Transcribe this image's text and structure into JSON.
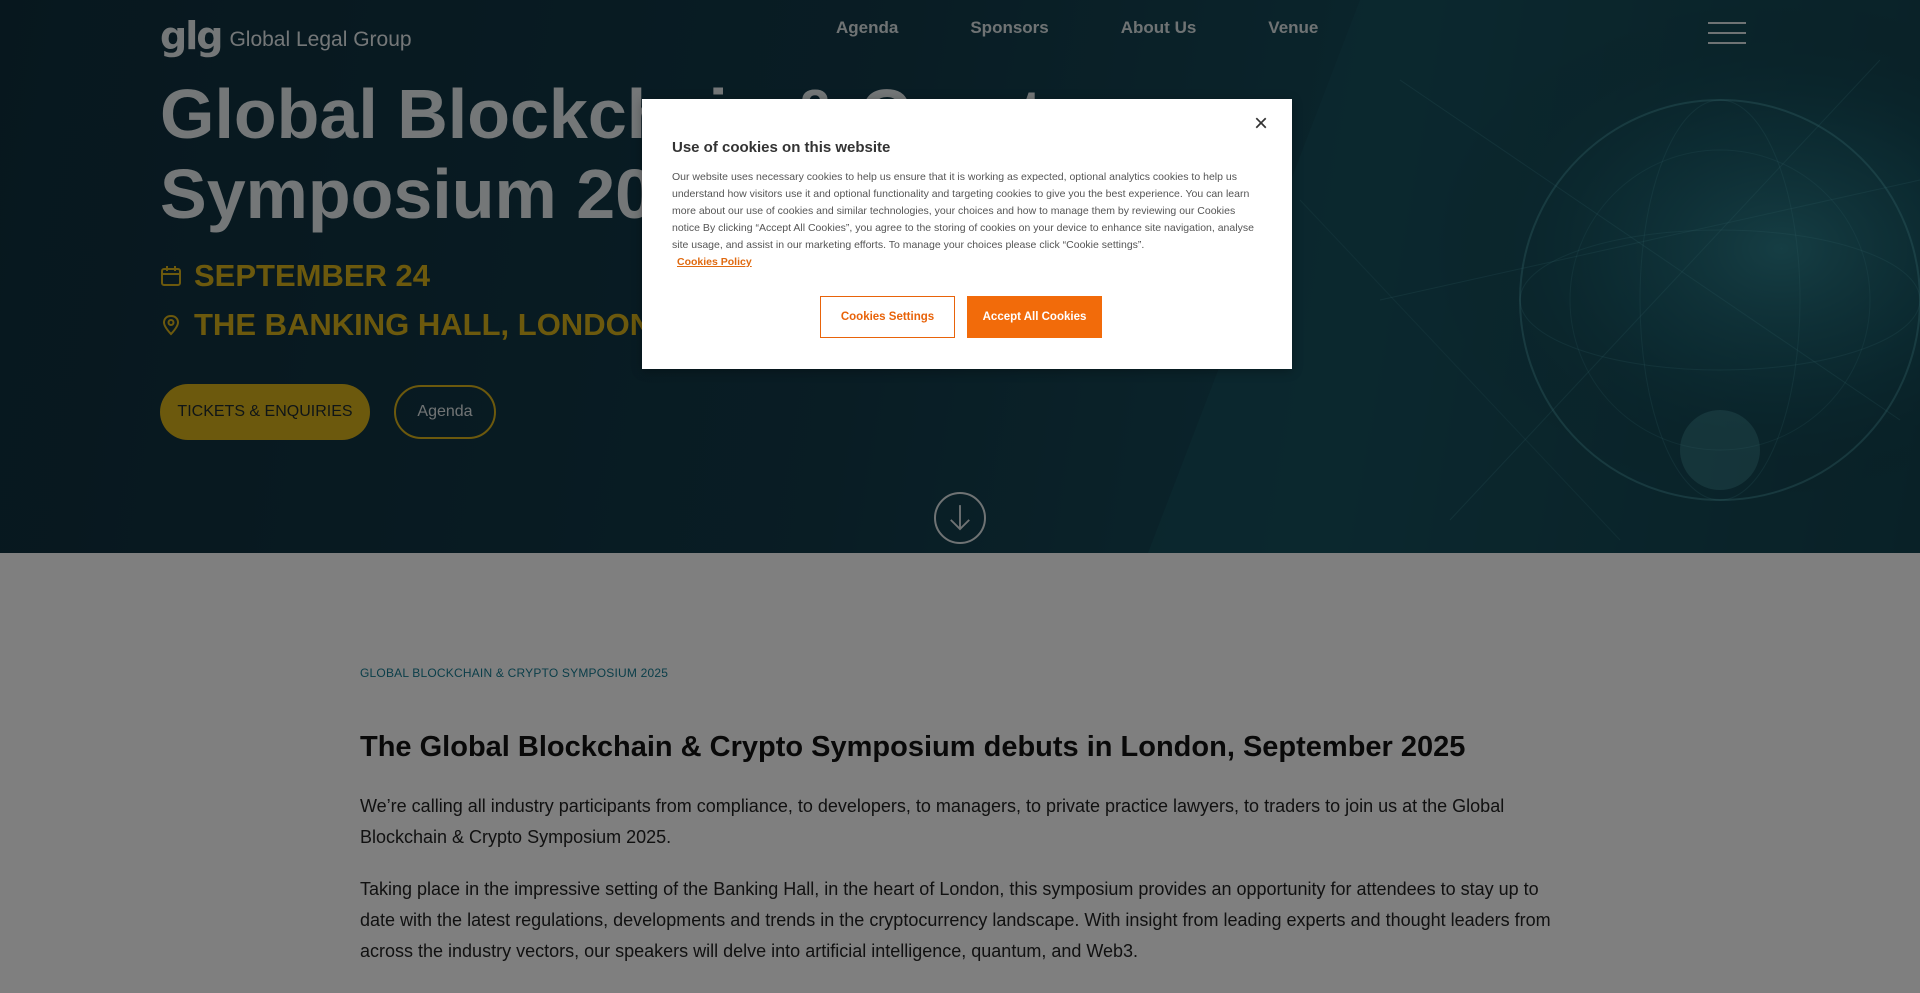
{
  "colors": {
    "accent_gold": "#d9b21a",
    "hero_dark": "#0f2f3d",
    "cookie_orange": "#f26b0a",
    "eyebrow_teal": "#167c92"
  },
  "header": {
    "logo_mark": "glg",
    "logo_text": "Global Legal Group",
    "nav": [
      "Agenda",
      "Sponsors",
      "About Us",
      "Venue"
    ],
    "menu_icon": "hamburger-icon"
  },
  "hero": {
    "title_line1": "Global Blockchain & Crypto",
    "title_line2": "Symposium 2025",
    "date": "SEPTEMBER 24",
    "date_icon": "calendar-icon",
    "location": "THE BANKING HALL, LONDON, UK",
    "location_icon": "location-pin-icon",
    "btn_tickets": "TICKETS & ENQUIRIES",
    "btn_agenda": "Agenda",
    "scroll_icon": "arrow-down-circle-icon"
  },
  "content": {
    "eyebrow": "GLOBAL BLOCKCHAIN & CRYPTO SYMPOSIUM 2025",
    "heading": "The Global Blockchain & Crypto Symposium debuts in London, September 2025",
    "p1": "We’re calling all industry participants from compliance, to developers, to managers, to private practice lawyers, to traders to join us at the Global Blockchain & Crypto Symposium 2025.",
    "p2": "Taking place in the impressive setting of the Banking Hall, in the heart of London, this symposium provides an opportunity for attendees to stay up to date with the latest regulations, developments and trends in the cryptocurrency landscape. With insight from leading experts and thought leaders from across the industry vectors, our speakers will delve into artificial intelligence, quantum, and Web3."
  },
  "cookie_modal": {
    "close_label": "×",
    "title": "Use of cookies on this website",
    "body": "Our website uses necessary cookies to help us ensure that it is working as expected, optional analytics cookies to help us understand how visitors use it and optional functionality and targeting cookies to give you the best experience. You can learn more about our use of cookies and similar technologies, your choices and how to manage them by reviewing our Cookies notice By clicking “Accept All Cookies”, you agree to the storing of cookies on your device to enhance site navigation, analyse site usage, and assist in our marketing efforts. To manage your choices please click “Cookie settings”.",
    "policy_link": "Cookies Policy",
    "btn_settings": "Cookies Settings",
    "btn_accept": "Accept All Cookies"
  }
}
